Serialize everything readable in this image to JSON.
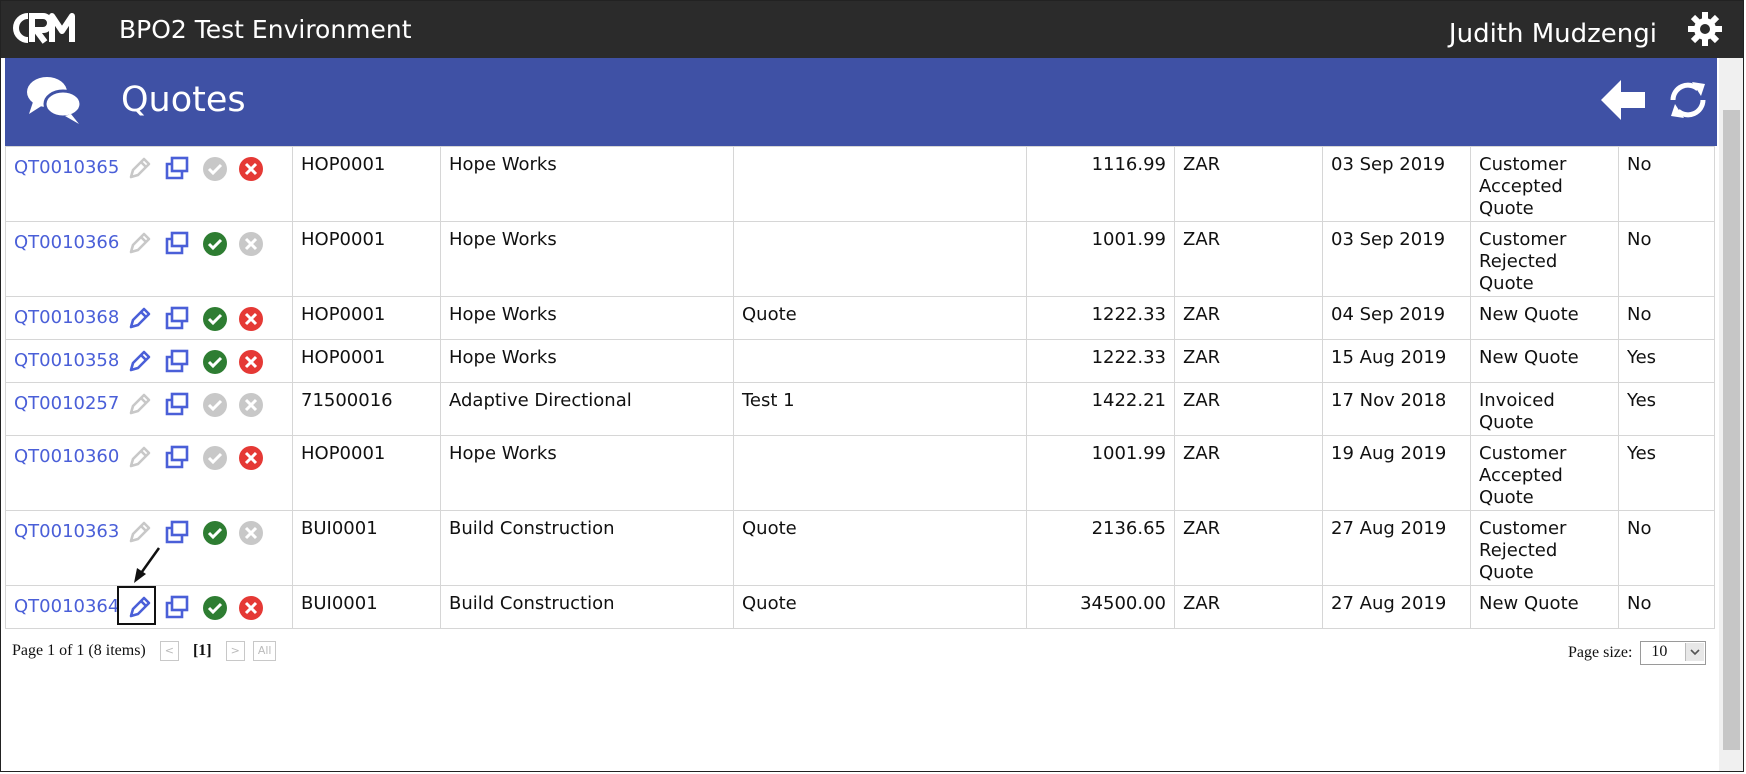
{
  "topbar": {
    "logo_text": "CRM",
    "env_title": "BPO2 Test Environment",
    "user_name": "Judith Mudzengi"
  },
  "header": {
    "page_title": "Quotes"
  },
  "icons": {
    "logo": "crm-logo",
    "settings": "gear-icon",
    "module": "chat-bubbles-icon",
    "back": "arrow-left-icon",
    "refresh": "refresh-icon",
    "edit": "pencil-icon",
    "copy": "copy-windows-icon",
    "accept": "check-circle-icon",
    "reject": "x-circle-icon"
  },
  "colors": {
    "topbar": "#2b2b2b",
    "header": "#3f51a5",
    "link": "#4a5fd8",
    "accept": "#2e7d32",
    "reject": "#e53935",
    "disabled": "#c8c8c8"
  },
  "rows": [
    {
      "id": "QT0010365",
      "edit": false,
      "accept": false,
      "reject": true,
      "code": "HOP0001",
      "company": "Hope Works",
      "desc": "",
      "amount": "1116.99",
      "currency": "ZAR",
      "date": "03 Sep 2019",
      "status": "Customer Accepted Quote",
      "flag": "No"
    },
    {
      "id": "QT0010366",
      "edit": false,
      "accept": true,
      "reject": false,
      "code": "HOP0001",
      "company": "Hope Works",
      "desc": "",
      "amount": "1001.99",
      "currency": "ZAR",
      "date": "03 Sep 2019",
      "status": "Customer Rejected Quote",
      "flag": "No"
    },
    {
      "id": "QT0010368",
      "edit": true,
      "accept": true,
      "reject": true,
      "code": "HOP0001",
      "company": "Hope Works",
      "desc": "Quote",
      "amount": "1222.33",
      "currency": "ZAR",
      "date": "04 Sep 2019",
      "status": "New Quote",
      "flag": "No"
    },
    {
      "id": "QT0010358",
      "edit": true,
      "accept": true,
      "reject": true,
      "code": "HOP0001",
      "company": "Hope Works",
      "desc": "",
      "amount": "1222.33",
      "currency": "ZAR",
      "date": "15 Aug 2019",
      "status": "New Quote",
      "flag": "Yes"
    },
    {
      "id": "QT0010257",
      "edit": false,
      "accept": false,
      "reject": false,
      "code": "71500016",
      "company": "Adaptive Directional",
      "desc": "Test 1",
      "amount": "1422.21",
      "currency": "ZAR",
      "date": "17 Nov 2018",
      "status": "Invoiced Quote",
      "flag": "Yes"
    },
    {
      "id": "QT0010360",
      "edit": false,
      "accept": false,
      "reject": true,
      "code": "HOP0001",
      "company": "Hope Works",
      "desc": "",
      "amount": "1001.99",
      "currency": "ZAR",
      "date": "19 Aug 2019",
      "status": "Customer Accepted Quote",
      "flag": "Yes"
    },
    {
      "id": "QT0010363",
      "edit": false,
      "accept": true,
      "reject": false,
      "code": "BUI0001",
      "company": "Build Construction",
      "desc": "Quote",
      "amount": "2136.65",
      "currency": "ZAR",
      "date": "27 Aug 2019",
      "status": "Customer Rejected Quote",
      "flag": "No"
    },
    {
      "id": "QT0010364",
      "edit": true,
      "accept": true,
      "reject": true,
      "code": "BUI0001",
      "company": "Build Construction",
      "desc": "Quote",
      "amount": "34500.00",
      "currency": "ZAR",
      "date": "27 Aug 2019",
      "status": "New Quote",
      "flag": "No"
    }
  ],
  "pager": {
    "info": "Page 1 of 1 (8 items)",
    "prev": "<",
    "current": "[1]",
    "next": ">",
    "all": "All"
  },
  "page_size": {
    "label": "Page size:",
    "value": "10"
  }
}
